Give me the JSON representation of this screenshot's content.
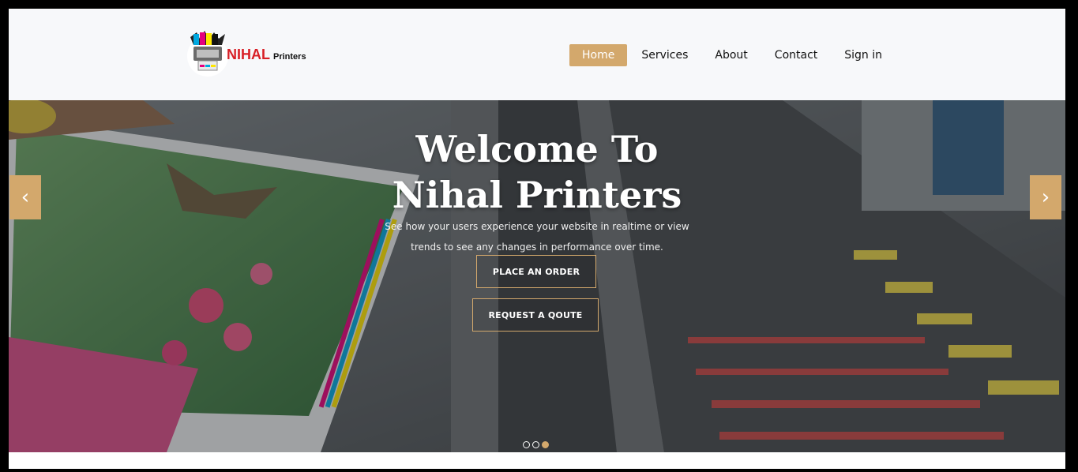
{
  "logo": {
    "brand": "NIHAL",
    "sub": "Printers"
  },
  "nav": {
    "items": [
      {
        "label": "Home",
        "active": true
      },
      {
        "label": "Services",
        "active": false
      },
      {
        "label": "About",
        "active": false
      },
      {
        "label": "Contact",
        "active": false
      },
      {
        "label": "Sign in",
        "active": false
      }
    ]
  },
  "hero": {
    "title_line1": "Welcome To",
    "title_line2": "Nihal Printers",
    "subtitle": "See how your users experience your website in realtime or view trends to see any changes in performance over time.",
    "primary_button": "PLACE AN ORDER",
    "secondary_button": "REQUEST A QOUTE",
    "prev_arrow": "‹",
    "next_arrow": "›",
    "slides_total": 3,
    "active_slide": 3
  },
  "colors": {
    "accent": "#d3a86c",
    "brand_red": "#d81f26",
    "header_bg": "#f7f8fa"
  },
  "icons": {
    "logo": "printer-logo-icon",
    "prev": "chevron-left-icon",
    "next": "chevron-right-icon"
  }
}
